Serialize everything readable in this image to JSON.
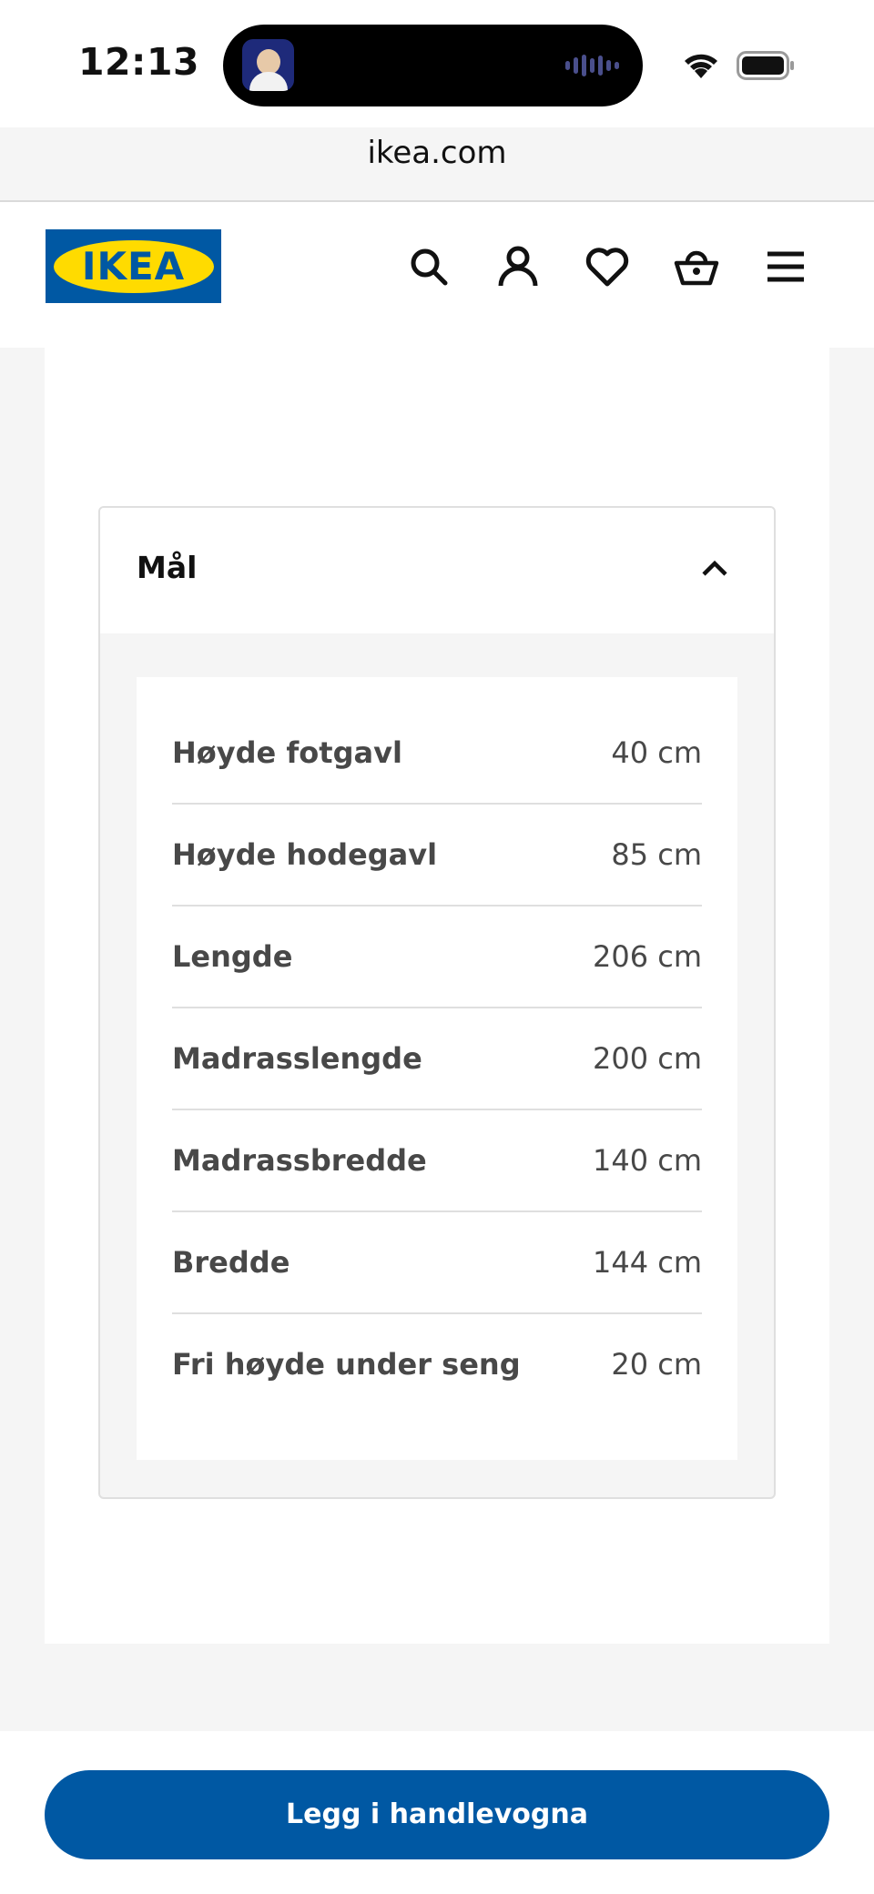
{
  "status_bar": {
    "time": "12:13"
  },
  "browser": {
    "url": "ikea.com"
  },
  "header": {
    "logo_text": "IKEA"
  },
  "accordion": {
    "title": "Mål",
    "rows": [
      {
        "label": "Høyde fotgavl",
        "value": "40 cm"
      },
      {
        "label": "Høyde hodegavl",
        "value": "85 cm"
      },
      {
        "label": "Lengde",
        "value": "206 cm"
      },
      {
        "label": "Madrasslengde",
        "value": "200 cm"
      },
      {
        "label": "Madrassbredde",
        "value": "140 cm"
      },
      {
        "label": "Bredde",
        "value": "144 cm"
      },
      {
        "label": "Fri høyde under seng",
        "value": "20 cm"
      }
    ]
  },
  "bottom_bar": {
    "cart_button_label": "Legg i handlevogna"
  },
  "colors": {
    "brand_blue": "#0058a3",
    "brand_yellow": "#ffdb00",
    "text": "#484848"
  }
}
